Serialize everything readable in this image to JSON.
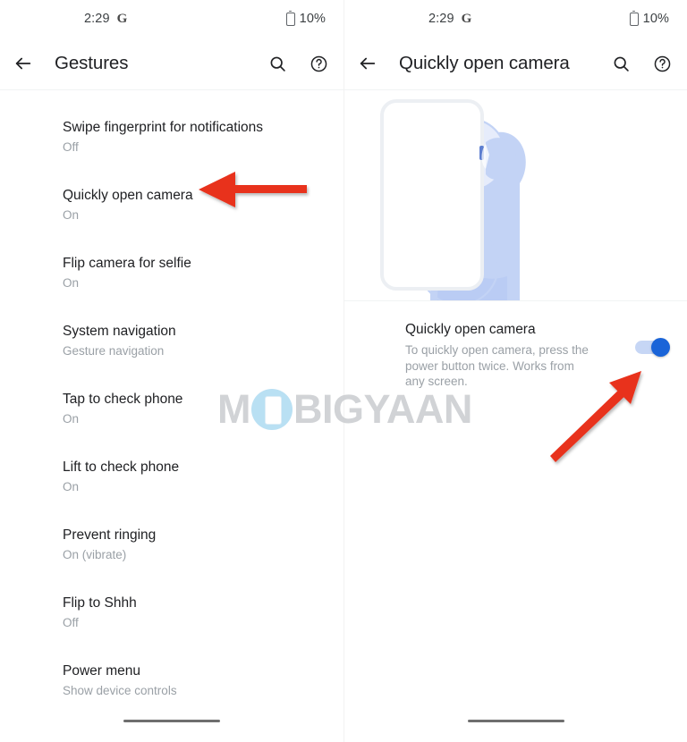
{
  "left_screen": {
    "status_bar": {
      "time": "2:29",
      "app_glyph": "G",
      "battery_text": "10%",
      "battery_icon": "battery-icon"
    },
    "app_bar": {
      "back_icon": "back-arrow-icon",
      "title": "Gestures",
      "search_icon": "search-icon",
      "help_icon": "help-circle-icon"
    },
    "items": [
      {
        "title": "Swipe fingerprint for notifications",
        "summary": "Off"
      },
      {
        "title": "Quickly open camera",
        "summary": "On"
      },
      {
        "title": "Flip camera for selfie",
        "summary": "On"
      },
      {
        "title": "System navigation",
        "summary": "Gesture navigation"
      },
      {
        "title": "Tap to check phone",
        "summary": "On"
      },
      {
        "title": "Lift to check phone",
        "summary": "On"
      },
      {
        "title": "Prevent ringing",
        "summary": "On (vibrate)"
      },
      {
        "title": "Flip to Shhh",
        "summary": "Off"
      },
      {
        "title": "Power menu",
        "summary": "Show device controls"
      }
    ]
  },
  "right_screen": {
    "status_bar": {
      "time": "2:29",
      "app_glyph": "G",
      "battery_text": "10%",
      "battery_icon": "battery-icon"
    },
    "app_bar": {
      "back_icon": "back-arrow-icon",
      "title": "Quickly open camera",
      "search_icon": "search-icon",
      "help_icon": "help-circle-icon"
    },
    "illustration": {
      "name": "hand-holding-phone-illustration"
    },
    "detail": {
      "title": "Quickly open camera",
      "description": "To quickly open camera, press the power button twice. Works from any screen.",
      "toggle_state": "on",
      "toggle_color": "#1a64d8",
      "toggle_track_color": "#c6d6f5"
    }
  },
  "annotations": {
    "arrow_color": "#e8301b",
    "arrow_left_target": "Quickly open camera list item",
    "arrow_right_target": "Quickly open camera toggle"
  },
  "watermark": {
    "text_before": "M",
    "text_after": "BIGYAAN",
    "full_text": "MOBIGYAAN",
    "color": "#c9cccf"
  },
  "home_indicator": {
    "name": "home-gesture-bar"
  }
}
